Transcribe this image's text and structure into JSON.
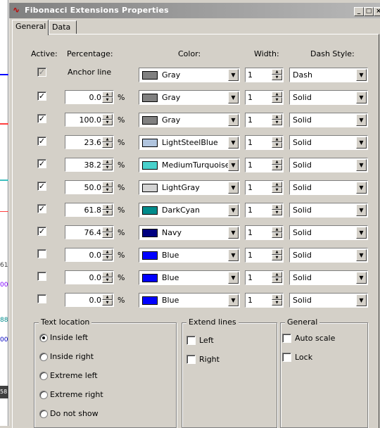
{
  "window": {
    "title": "Fibonacci Extensions Properties",
    "buttons": [
      "_",
      "□",
      "×"
    ]
  },
  "tabs": [
    {
      "label": "General",
      "active": true
    },
    {
      "label": "Data",
      "active": false
    }
  ],
  "headers": {
    "active": "Active:",
    "percentage": "Percentage:",
    "color": "Color:",
    "width": "Width:",
    "dash_style": "Dash Style:"
  },
  "anchor": {
    "label": "Anchor line",
    "checked": true,
    "disabled": true,
    "color": {
      "name": "Gray",
      "hex": "#808080"
    },
    "width": "1",
    "dash": "Dash"
  },
  "levels": [
    {
      "checked": true,
      "value": "0.0",
      "color": {
        "name": "Gray",
        "hex": "#808080"
      },
      "width": "1",
      "dash": "Solid"
    },
    {
      "checked": true,
      "value": "100.0",
      "color": {
        "name": "Gray",
        "hex": "#808080"
      },
      "width": "1",
      "dash": "Solid"
    },
    {
      "checked": true,
      "value": "23.6",
      "color": {
        "name": "LightSteelBlue",
        "hex": "#b0c4de"
      },
      "width": "1",
      "dash": "Solid"
    },
    {
      "checked": true,
      "value": "38.2",
      "color": {
        "name": "MediumTurquoise",
        "hex": "#48d1cc"
      },
      "width": "1",
      "dash": "Solid"
    },
    {
      "checked": true,
      "value": "50.0",
      "color": {
        "name": "LightGray",
        "hex": "#d3d3d3"
      },
      "width": "1",
      "dash": "Solid"
    },
    {
      "checked": true,
      "value": "61.8",
      "color": {
        "name": "DarkCyan",
        "hex": "#008b8b"
      },
      "width": "1",
      "dash": "Solid"
    },
    {
      "checked": true,
      "value": "76.4",
      "color": {
        "name": "Navy",
        "hex": "#000080"
      },
      "width": "1",
      "dash": "Solid"
    },
    {
      "checked": false,
      "value": "0.0",
      "color": {
        "name": "Blue",
        "hex": "#0000ff"
      },
      "width": "1",
      "dash": "Solid"
    },
    {
      "checked": false,
      "value": "0.0",
      "color": {
        "name": "Blue",
        "hex": "#0000ff"
      },
      "width": "1",
      "dash": "Solid"
    },
    {
      "checked": false,
      "value": "0.0",
      "color": {
        "name": "Blue",
        "hex": "#0000ff"
      },
      "width": "1",
      "dash": "Solid"
    }
  ],
  "percent_symbol": "%",
  "text_location": {
    "title": "Text location",
    "options": [
      {
        "label": "Inside left",
        "selected": true
      },
      {
        "label": "Inside right",
        "selected": false
      },
      {
        "label": "Extreme left",
        "selected": false
      },
      {
        "label": "Extreme right",
        "selected": false
      },
      {
        "label": "Do not show",
        "selected": false
      }
    ]
  },
  "extend_lines": {
    "title": "Extend lines",
    "options": [
      {
        "label": "Left",
        "checked": false
      },
      {
        "label": "Right",
        "checked": false
      }
    ]
  },
  "general": {
    "title": "General",
    "options": [
      {
        "label": "Auto scale",
        "checked": false
      },
      {
        "label": "Lock",
        "checked": false
      }
    ]
  },
  "chart_strip": {
    "labels": [
      "61",
      "00",
      "88",
      "00",
      "58"
    ]
  },
  "colors": {
    "titlebar_start": "#808080",
    "titlebar_end": "#b8b8b8",
    "dialog_bg": "#d4d0c8"
  }
}
